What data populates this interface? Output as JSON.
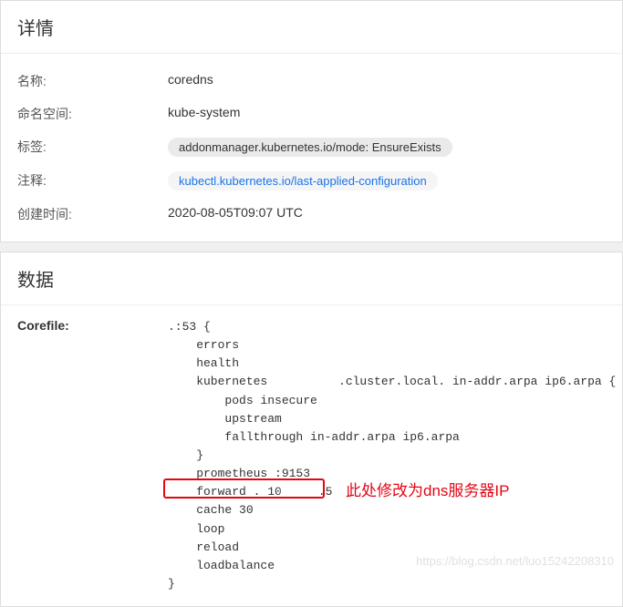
{
  "details": {
    "header": "详情",
    "rows": {
      "name_label": "名称:",
      "name_value": "coredns",
      "namespace_label": "命名空间:",
      "namespace_value": "kube-system",
      "tag_label": "标签:",
      "tag_value": "addonmanager.kubernetes.io/mode: EnsureExists",
      "anno_label": "注释:",
      "anno_value": "kubectl.kubernetes.io/last-applied-configuration",
      "created_label": "创建时间:",
      "created_value": "2020-08-05T09:07 UTC"
    }
  },
  "data": {
    "header": "数据",
    "corefile_label": "Corefile:",
    "corefile_lines": {
      "l0": ".:53 {",
      "l1": "    errors",
      "l2": "    health",
      "l3a": "    kubernetes ",
      "l3b": ".cluster.local. in-addr.arpa ip6.arpa {",
      "l4": "        pods insecure",
      "l5": "        upstream",
      "l6": "        fallthrough in-addr.arpa ip6.arpa",
      "l7": "    }",
      "l8": "    prometheus :9153",
      "l9a": "    forward . 10",
      "l9b": ".5",
      "l10": "    cache 30",
      "l11": "    loop",
      "l12": "    reload",
      "l13": "    loadbalance",
      "l14": "}"
    },
    "annotation": "此处修改为dns服务器IP"
  },
  "watermark": "https://blog.csdn.net/luo15242208310"
}
